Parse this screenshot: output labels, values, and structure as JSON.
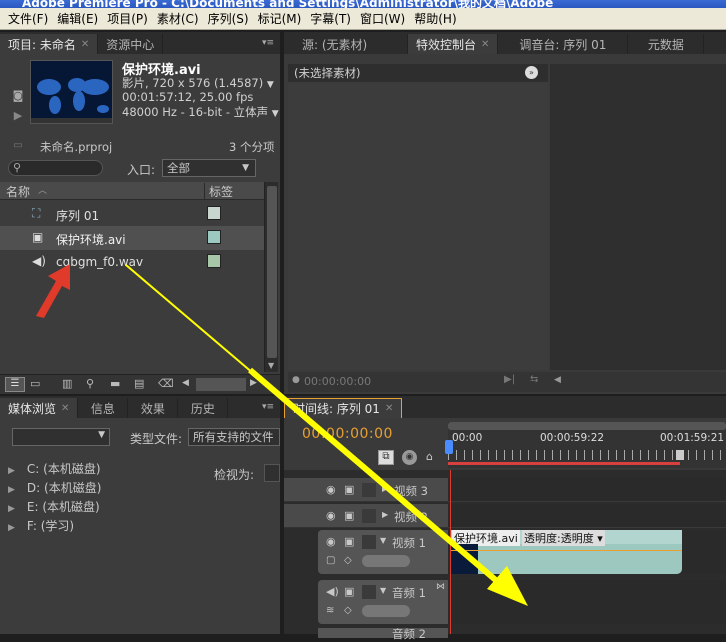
{
  "title_fragment": "Adobe Premiere Pro - C:\\Documents and Settings\\Administrator\\我的文档\\Adobe",
  "menu": [
    "文件(F)",
    "编辑(E)",
    "项目(P)",
    "素材(C)",
    "序列(S)",
    "标记(M)",
    "字幕(T)",
    "窗口(W)",
    "帮助(H)"
  ],
  "project": {
    "tabs": [
      "项目: 未命名",
      "资源中心"
    ],
    "clip_name": "保护环境.avi",
    "clip_info": [
      "影片, 720 x 576 (1.4587)",
      "00:01:57:12, 25.00 fps",
      "48000 Hz - 16-bit - 立体声"
    ],
    "project_file": "未命名.prproj",
    "item_count": "3 个分项",
    "entry_label": "入口:",
    "entry_value": "全部",
    "col_name": "名称",
    "col_label": "标签",
    "items": [
      {
        "name": "序列 01",
        "color": "#c9d6d0",
        "icon": "sequence-icon"
      },
      {
        "name": "保护环境.avi",
        "color": "#9cc8c0",
        "icon": "video-file-icon"
      },
      {
        "name": "cgbgm_f0.wav",
        "color": "#a8c6a8",
        "icon": "audio-file-icon"
      }
    ]
  },
  "monitor": {
    "tabs": [
      "源: (无素材)",
      "特效控制台",
      "调音台: 序列 01",
      "元数据"
    ],
    "no_clip": "(未选择素材)",
    "timecode": "00:00:00:00"
  },
  "media": {
    "tabs": [
      "媒体浏览",
      "信息",
      "效果",
      "历史"
    ],
    "file_type_label": "类型文件:",
    "file_type_value": "所有支持的文件",
    "view_as_label": "检视为:",
    "drives": [
      "C: (本机磁盘)",
      "D: (本机磁盘)",
      "E: (本机磁盘)",
      "F: (学习)"
    ]
  },
  "timeline": {
    "tab": "时间线: 序列 01",
    "timecode": "00:00:00:00",
    "ruler": [
      "00:00",
      "00:00:59:22",
      "00:01:59:21"
    ],
    "tracks": [
      "视频 3",
      "视频 2",
      "视频 1",
      "音频 1",
      "音频 2"
    ],
    "clip_label": "保护环境.avi",
    "clip_fx": "透明度:透明度"
  },
  "colors": {
    "accent": "#e8a030",
    "annotation_arrow": "#ffff00",
    "red_arrow": "#e03a2a",
    "clip": "#9cc8c0"
  }
}
